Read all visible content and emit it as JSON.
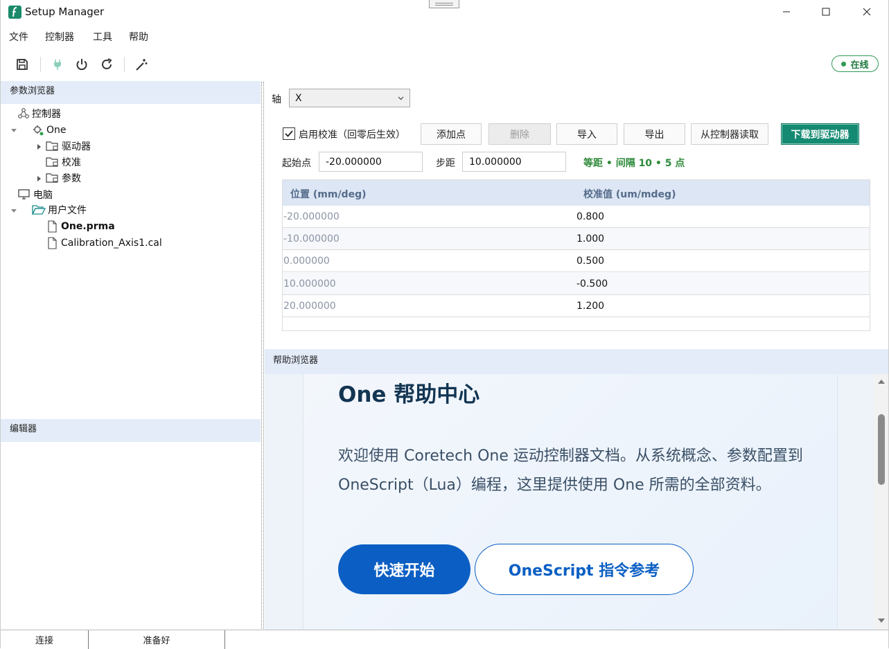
{
  "window": {
    "title": "Setup Manager"
  },
  "menu": [
    "文件",
    "控制器",
    "工具",
    "帮助"
  ],
  "status_pill": "在线",
  "colors": {
    "accent": "#148a72",
    "online": "#2e9a55",
    "primary_button": "#0b5fc4",
    "panel_header": "#e3ecf8"
  },
  "param_browser": {
    "title": "参数浏览器",
    "tree": {
      "controller": "控制器",
      "one": "One",
      "drivers": "驱动器",
      "calibration": "校准",
      "params": "参数",
      "computer": "电脑",
      "user_files": "用户文件",
      "file1": "One.prma",
      "file2": "Calibration_Axis1.cal"
    }
  },
  "editor": {
    "title": "编辑器"
  },
  "calib": {
    "axis_label": "轴",
    "axis_value": "X",
    "enable_label": "启用校准（回零后生效）",
    "enable_checked": true,
    "buttons": {
      "add": "添加点",
      "delete": "删除",
      "import": "导入",
      "export": "导出",
      "read": "从控制器读取",
      "download": "下载到驱动器"
    },
    "start_label": "起始点",
    "start_value": "-20.000000",
    "step_label": "步距",
    "step_value": "10.000000",
    "summary": "等距 • 间隔 10 • 5 点",
    "columns": [
      "位置 (mm/deg)",
      "校准值 (um/mdeg)"
    ],
    "rows": [
      [
        "-20.000000",
        "0.800"
      ],
      [
        "-10.000000",
        "1.000"
      ],
      [
        "0.000000",
        "0.500"
      ],
      [
        "10.000000",
        "-0.500"
      ],
      [
        "20.000000",
        "1.200"
      ]
    ]
  },
  "help": {
    "title": "帮助浏览器",
    "heading": "One 帮助中心",
    "text": "欢迎使用 Coretech One 运动控制器文档。从系统概念、参数配置到 OneScript（Lua）编程，这里提供使用 One 所需的全部资料。",
    "btn_primary": "快速开始",
    "btn_secondary": "OneScript 指令参考"
  },
  "status": {
    "left": "连接",
    "mid": "准备好"
  }
}
